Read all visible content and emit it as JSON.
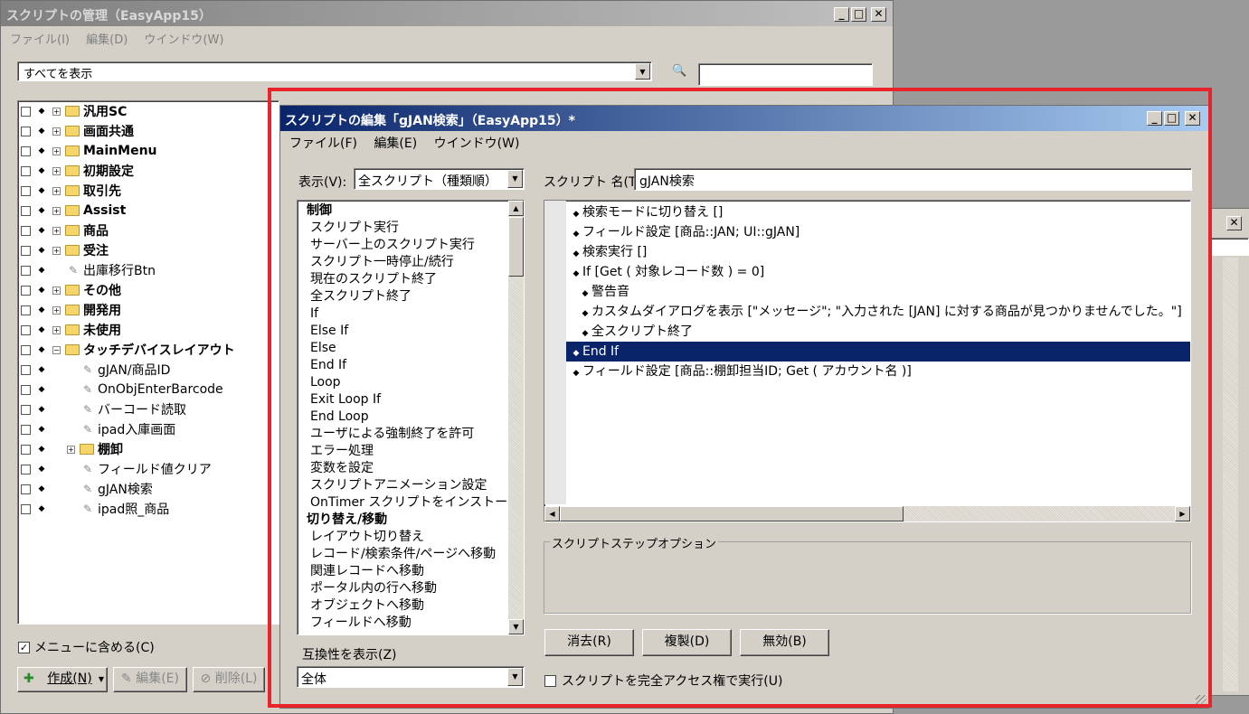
{
  "manage": {
    "title": "スクリプトの管理（EasyApp15）",
    "menu": [
      "ファイル(I)",
      "編集(D)",
      "ウインドウ(W)"
    ],
    "filter_value": "すべてを表示",
    "search_value": "",
    "tree": [
      {
        "label": "汎用SC",
        "type": "folder",
        "bold": true
      },
      {
        "label": "画面共通",
        "type": "folder",
        "bold": true
      },
      {
        "label": "MainMenu",
        "type": "folder",
        "bold": true
      },
      {
        "label": "初期設定",
        "type": "folder",
        "bold": true
      },
      {
        "label": "取引先",
        "type": "folder",
        "bold": true
      },
      {
        "label": "Assist",
        "type": "folder",
        "bold": true
      },
      {
        "label": "商品",
        "type": "folder",
        "bold": true
      },
      {
        "label": "受注",
        "type": "folder",
        "bold": true
      },
      {
        "label": "出庫移行Btn",
        "type": "script",
        "bold": false
      },
      {
        "label": "その他",
        "type": "folder",
        "bold": true
      },
      {
        "label": "開発用",
        "type": "folder",
        "bold": true
      },
      {
        "label": "未使用",
        "type": "folder",
        "bold": true
      },
      {
        "label": "タッチデバイスレイアウト",
        "type": "folder-open",
        "bold": true
      },
      {
        "label": "gJAN/商品ID",
        "type": "script",
        "bold": false
      },
      {
        "label": "OnObjEnterBarcode",
        "type": "script",
        "bold": false
      },
      {
        "label": "バーコード読取",
        "type": "script",
        "bold": false
      },
      {
        "label": "ipad入庫画面",
        "type": "script",
        "bold": false
      },
      {
        "label": "棚卸",
        "type": "subfolder",
        "bold": true
      },
      {
        "label": "フィールド値クリア",
        "type": "script",
        "bold": false
      },
      {
        "label": "gJAN検索",
        "type": "script",
        "bold": false
      },
      {
        "label": "ipad照_商品",
        "type": "script",
        "bold": false
      }
    ],
    "include_menu_label": "メニューに含める(C)",
    "create_label": "作成(N)",
    "edit_label": "編集(E)",
    "delete_label": "削除(L)"
  },
  "edit": {
    "title": "スクリプトの編集「gJAN検索」（EasyApp15）*",
    "menu": [
      "ファイル(F)",
      "編集(E)",
      "ウインドウ(W)"
    ],
    "view_label": "表示(V):",
    "view_value": "全スクリプト（種類順）",
    "script_name_label": "スクリプト 名(T):",
    "script_name_value": "gJAN検索",
    "step_list": [
      {
        "label": "制御",
        "header": true
      },
      {
        "label": "スクリプト実行",
        "header": false
      },
      {
        "label": "サーバー上のスクリプト実行",
        "header": false
      },
      {
        "label": "スクリプト一時停止/続行",
        "header": false
      },
      {
        "label": "現在のスクリプト終了",
        "header": false
      },
      {
        "label": "全スクリプト終了",
        "header": false
      },
      {
        "label": "If",
        "header": false
      },
      {
        "label": "Else If",
        "header": false
      },
      {
        "label": "Else",
        "header": false
      },
      {
        "label": "End If",
        "header": false
      },
      {
        "label": "Loop",
        "header": false
      },
      {
        "label": "Exit Loop If",
        "header": false
      },
      {
        "label": "End Loop",
        "header": false
      },
      {
        "label": "ユーザによる強制終了を許可",
        "header": false
      },
      {
        "label": "エラー処理",
        "header": false
      },
      {
        "label": "変数を設定",
        "header": false
      },
      {
        "label": "スクリプトアニメーション設定",
        "header": false
      },
      {
        "label": "OnTimer スクリプトをインストール",
        "header": false
      },
      {
        "label": "切り替え/移動",
        "header": true
      },
      {
        "label": "レイアウト切り替え",
        "header": false
      },
      {
        "label": "レコード/検索条件/ページへ移動",
        "header": false
      },
      {
        "label": "関連レコードへ移動",
        "header": false
      },
      {
        "label": "ポータル内の行へ移動",
        "header": false
      },
      {
        "label": "オブジェクトへ移動",
        "header": false
      },
      {
        "label": "フィールドへ移動",
        "header": false
      }
    ],
    "steps": [
      {
        "text": "検索モードに切り替え []",
        "indent": 0,
        "selected": false
      },
      {
        "text": "フィールド設定 [商品::JAN; UI::gJAN]",
        "indent": 0,
        "selected": false
      },
      {
        "text": "検索実行 []",
        "indent": 0,
        "selected": false
      },
      {
        "text": "If [Get ( 対象レコード数 ) = 0]",
        "indent": 0,
        "selected": false
      },
      {
        "text": "警告音",
        "indent": 1,
        "selected": false
      },
      {
        "text": "カスタムダイアログを表示 [\"メッセージ\"; \"入力された [JAN] に対する商品が見つかりませんでした。\"]",
        "indent": 1,
        "selected": false
      },
      {
        "text": "全スクリプト終了",
        "indent": 1,
        "selected": false
      },
      {
        "text": "End If",
        "indent": 0,
        "selected": true
      },
      {
        "text": "フィールド設定 [商品::棚卸担当ID; Get ( アカウント名 )]",
        "indent": 0,
        "selected": false
      }
    ],
    "options_label": "スクリプトステップオプション",
    "compat_label": "互換性を表示(Z)",
    "compat_value": "全体",
    "clear_label": "消去(R)",
    "duplicate_label": "複製(D)",
    "disable_label": "無効(B)",
    "full_access_label": "スクリプトを完全アクセス権で実行(U)"
  },
  "colors": {
    "highlight": "#e8232a",
    "selection": "#0a246a",
    "titlebar_start": "#0a246a",
    "titlebar_end": "#a6caf0"
  }
}
